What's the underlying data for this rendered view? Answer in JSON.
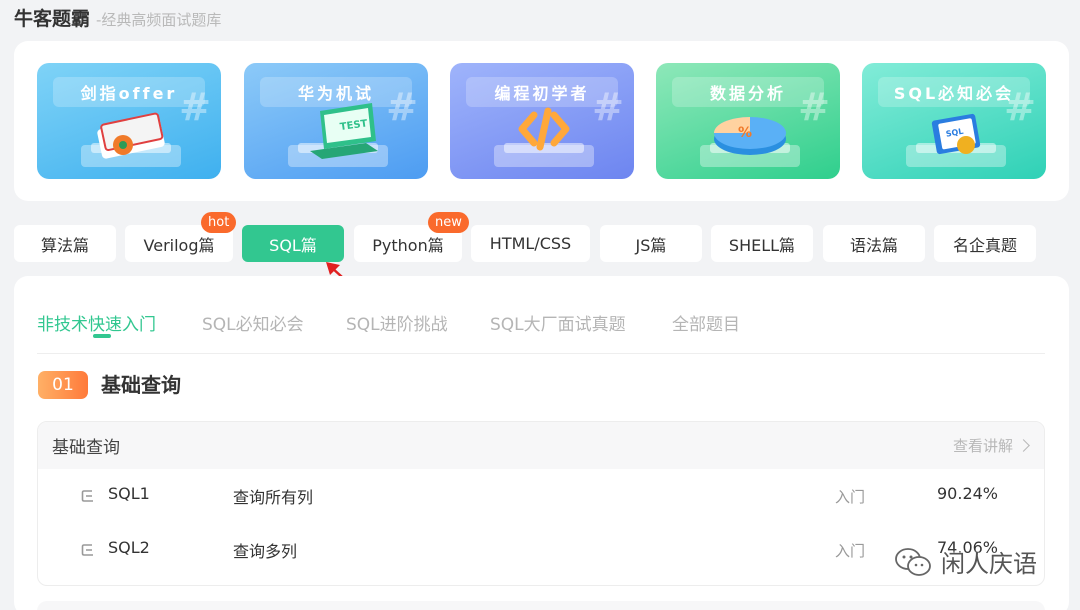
{
  "header": {
    "brand": "牛客题霸",
    "slogan": "-经典高频面试题库"
  },
  "banners": [
    {
      "title": "剑指offer",
      "icon": "book-icon"
    },
    {
      "title": "华为机试",
      "icon": "laptop-icon"
    },
    {
      "title": "编程初学者",
      "icon": "code-icon"
    },
    {
      "title": "数据分析",
      "icon": "pie-chart-icon"
    },
    {
      "title": "SQL必知必会",
      "icon": "sql-book-icon"
    }
  ],
  "categories": [
    {
      "label": "算法篇"
    },
    {
      "label": "Verilog篇",
      "badge": "hot"
    },
    {
      "label": "SQL篇",
      "active": true
    },
    {
      "label": "Python篇",
      "badge": "new"
    },
    {
      "label": "HTML/CSS"
    },
    {
      "label": "JS篇"
    },
    {
      "label": "SHELL篇"
    },
    {
      "label": "语法篇"
    },
    {
      "label": "名企真题"
    }
  ],
  "subtabs": [
    "非技术快速入门",
    "SQL必知必会",
    "SQL进阶挑战",
    "SQL大厂面试真题",
    "全部题目"
  ],
  "section": {
    "number": "01",
    "title": "基础查询"
  },
  "problem_group": {
    "title": "基础查询",
    "view_link": "查看讲解",
    "rows": [
      {
        "code": "SQL1",
        "name": "查询所有列",
        "difficulty": "入门",
        "pass_rate": "90.24%"
      },
      {
        "code": "SQL2",
        "name": "查询多列",
        "difficulty": "入门",
        "pass_rate": "74.06%"
      }
    ]
  },
  "watermark": "闲人庆语",
  "colors": {
    "accent": "#32c790",
    "badge": "#fa6a2c",
    "annotation_arrow": "#e02020"
  }
}
